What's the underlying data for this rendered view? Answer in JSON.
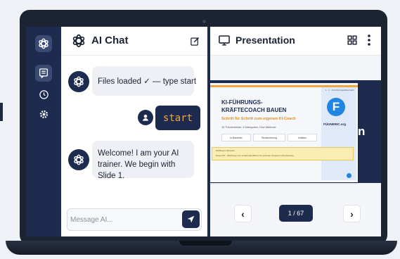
{
  "chat": {
    "title": "AI Chat",
    "messages": [
      {
        "role": "assistant",
        "text": "Files loaded ✓ — type start"
      },
      {
        "role": "user",
        "text": "start"
      },
      {
        "role": "assistant",
        "text": "Welcome! I am your AI trainer. We begin with Slide 1."
      }
    ],
    "input_placeholder": "Message AI..."
  },
  "presentation": {
    "title": "Presentation",
    "slide": {
      "title_line1": "KI-FÜHRUNGS-",
      "title_line2": "KRÄFTECOACH BAUEN",
      "subtitle": "Schritt für Schritt zum eigenen KI-Coach",
      "small_line": "15 Themenfelder, 6 Kategorien, Eine Methode",
      "chips": [
        "In Bauleiter",
        "Strukturierung",
        "Initiales"
      ],
      "brand": "FÜGNERIC.org",
      "note_title": "Hilf Bauen Hinweise",
      "note_text": "Diese KPI - Werkzeug zum erstellt Handlichen für optimale Vorgehen Unterweisung",
      "big_text": "n",
      "logo_letter": "F",
      "corner_text": "1 · 1 · KI-Führungskräftecoach"
    },
    "page_indicator": "1 / 67",
    "prev_label": "‹",
    "next_label": "›"
  },
  "colors": {
    "navy": "#1d2b4f",
    "accent_orange": "#f0a640",
    "brand_blue": "#1f86e4",
    "note_yellow": "#fcedb5"
  },
  "icons": {
    "rail": [
      "openai-logo-icon",
      "chat-icon",
      "history-icon",
      "settings-icon"
    ],
    "chat_header": [
      "openai-logo-icon",
      "edit-icon"
    ],
    "pres_header": [
      "monitor-icon",
      "grid-icon",
      "more-vertical-icon"
    ],
    "send": "send-icon",
    "user": "user-icon"
  }
}
